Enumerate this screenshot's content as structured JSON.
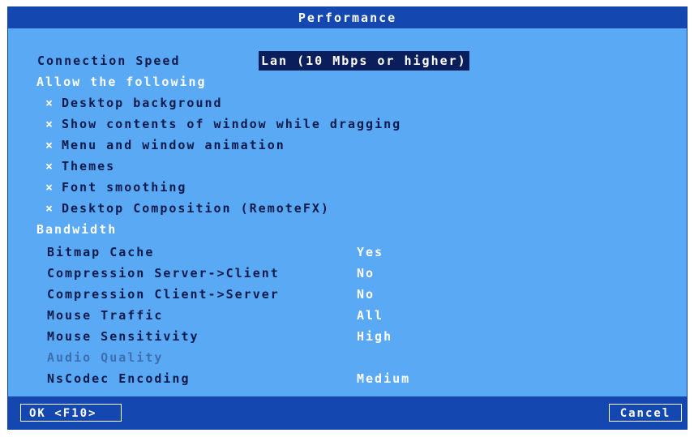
{
  "window": {
    "title": "Performance"
  },
  "connection": {
    "label": "Connection Speed",
    "value": "Lan (10 Mbps or higher)"
  },
  "allow": {
    "heading": "Allow the following",
    "options": [
      {
        "check": "×",
        "label": "Desktop background"
      },
      {
        "check": "×",
        "label": "Show contents of window while dragging"
      },
      {
        "check": "×",
        "label": "Menu and window animation"
      },
      {
        "check": "×",
        "label": "Themes"
      },
      {
        "check": "×",
        "label": "Font smoothing"
      },
      {
        "check": "×",
        "label": "Desktop Composition (RemoteFX)"
      }
    ]
  },
  "bandwidth": {
    "heading": "Bandwidth",
    "rows": [
      {
        "label": "Bitmap Cache",
        "value": "Yes"
      },
      {
        "label": "Compression Server->Client",
        "value": "No"
      },
      {
        "label": "Compression Client->Server",
        "value": "No"
      },
      {
        "label": "Mouse Traffic",
        "value": "All"
      },
      {
        "label": "Mouse Sensitivity",
        "value": "High"
      },
      {
        "label": "Audio Quality",
        "value": ""
      },
      {
        "label": "NsCodec Encoding",
        "value": "Medium"
      }
    ]
  },
  "footer": {
    "ok_label": "OK <F10>",
    "cancel_label": "Cancel"
  },
  "colors": {
    "panel_bg": "#5aa9f5",
    "title_bg": "#1447b0",
    "selection_bg": "#0a1e5c",
    "text_dark": "#0b1a4a",
    "text_light": "#ffffff",
    "disabled": "#3d6fb0"
  }
}
